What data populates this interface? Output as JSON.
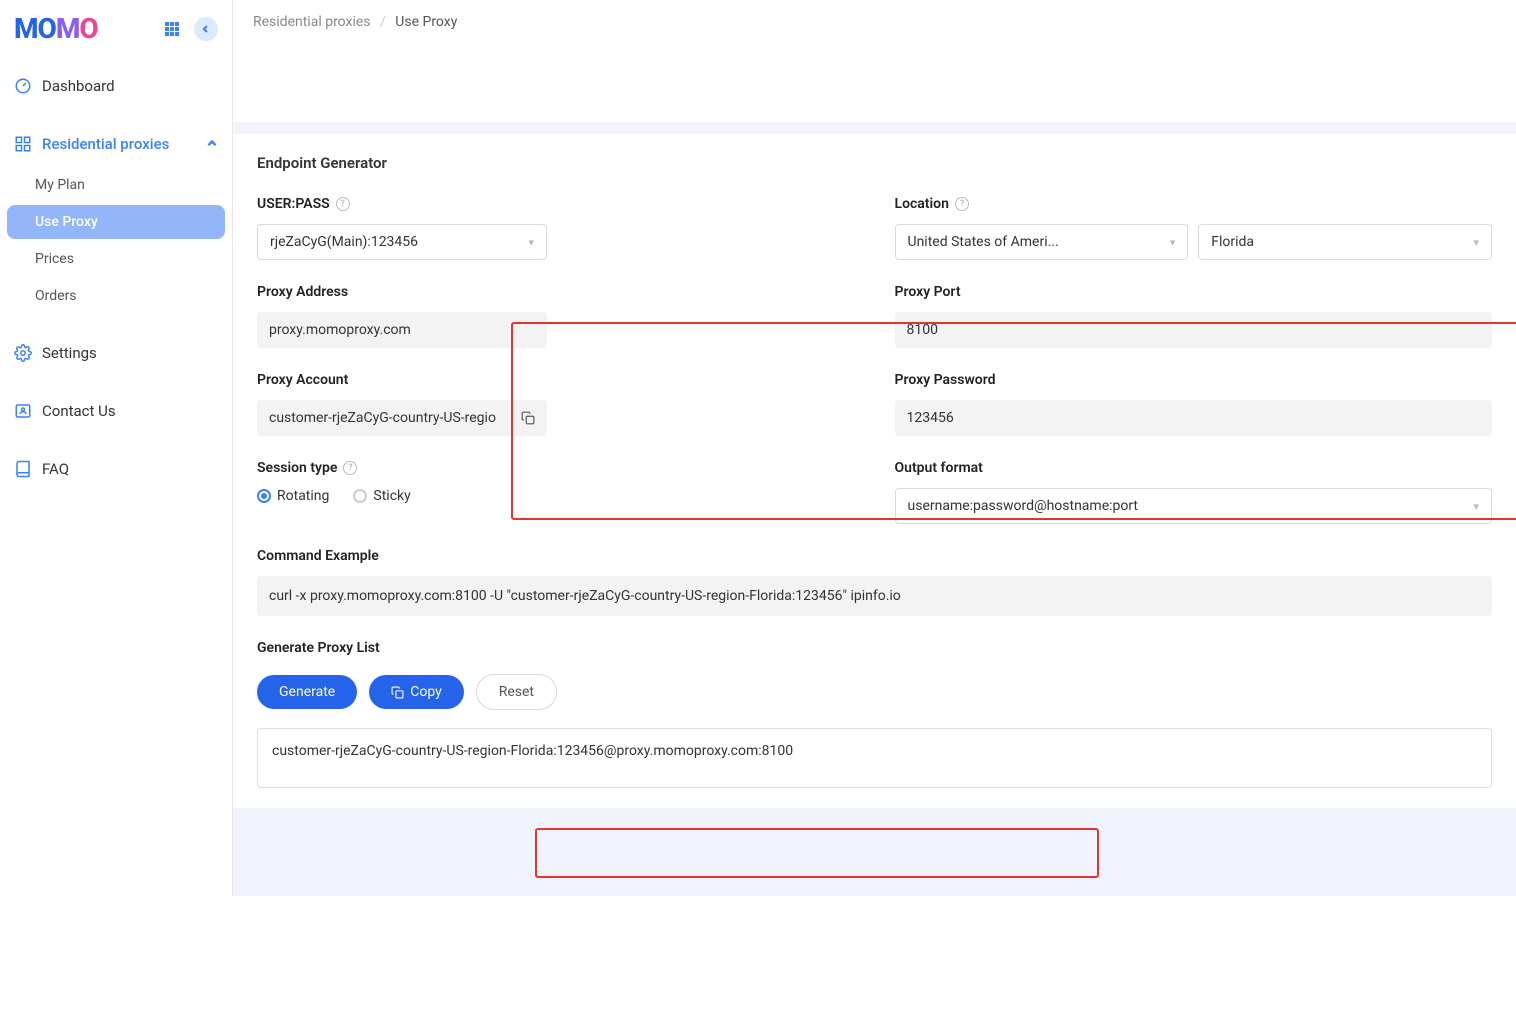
{
  "logo": {
    "m1": "M",
    "o1": "O",
    "m2": "M",
    "o2": "O"
  },
  "breadcrumb": {
    "root": "Residential proxies",
    "current": "Use Proxy"
  },
  "sidebar": {
    "dashboard": "Dashboard",
    "res_proxies": "Residential proxies",
    "sub": {
      "my_plan": "My Plan",
      "use_proxy": "Use Proxy",
      "prices": "Prices",
      "orders": "Orders"
    },
    "settings": "Settings",
    "contact": "Contact Us",
    "faq": "FAQ"
  },
  "section": {
    "endpoint_gen": "Endpoint Generator"
  },
  "labels": {
    "user_pass": "USER:PASS",
    "location": "Location",
    "proxy_address": "Proxy Address",
    "proxy_port": "Proxy Port",
    "proxy_account": "Proxy Account",
    "proxy_password": "Proxy Password",
    "session_type": "Session type",
    "output_format": "Output format",
    "command_example": "Command Example",
    "generate_list": "Generate Proxy List"
  },
  "values": {
    "user_pass": "rjeZaCyG(Main):123456",
    "country": "United States of Ameri...",
    "state": "Florida",
    "proxy_address": "proxy.momoproxy.com",
    "proxy_port": "8100",
    "proxy_account": "customer-rjeZaCyG-country-US-regio",
    "proxy_password": "123456",
    "output_format": "username:password@hostname:port",
    "command": "curl -x proxy.momoproxy.com:8100 -U \"customer-rjeZaCyG-country-US-region-Florida:123456\" ipinfo.io",
    "result": "customer-rjeZaCyG-country-US-region-Florida:123456@proxy.momoproxy.com:8100"
  },
  "session": {
    "rotating": "Rotating",
    "sticky": "Sticky"
  },
  "buttons": {
    "generate": "Generate",
    "copy": "Copy",
    "reset": "Reset"
  }
}
